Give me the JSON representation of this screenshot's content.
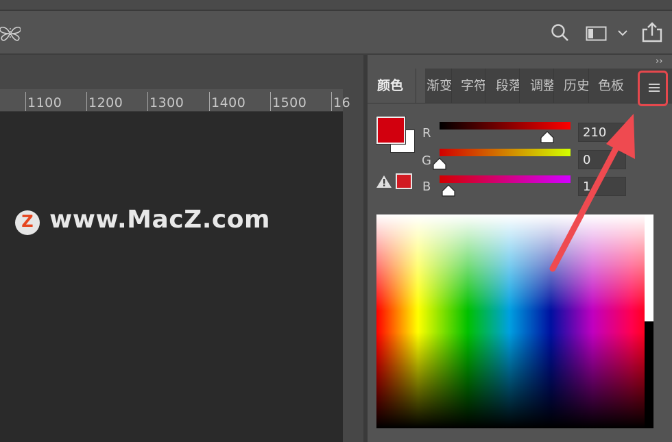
{
  "ruler": {
    "labels": [
      "1100",
      "1200",
      "1300",
      "1400",
      "1500",
      "16"
    ]
  },
  "watermark": {
    "logo_letter": "Z",
    "text": "www.MacZ.com"
  },
  "panel": {
    "collapse_glyph": "››",
    "tabs": [
      "颜色",
      "渐变",
      "字符",
      "段落",
      "调整",
      "历史",
      "色板"
    ],
    "menu_icon": "hamburger-menu-icon"
  },
  "color": {
    "foreground": "#d2000e",
    "background": "#ffffff",
    "r_label": "R",
    "g_label": "G",
    "b_label": "B",
    "r_value": "210",
    "g_value": "0",
    "b_value": "1",
    "r": 210,
    "g": 0,
    "b": 18
  },
  "toolbar": {
    "icons": [
      "butterfly-icon",
      "search-icon",
      "workspace-icon",
      "chevron-down-icon",
      "share-icon"
    ]
  },
  "colors": {
    "highlight": "#e5484d",
    "panel_bg": "#535353",
    "document_bg": "#2a2a2a"
  }
}
